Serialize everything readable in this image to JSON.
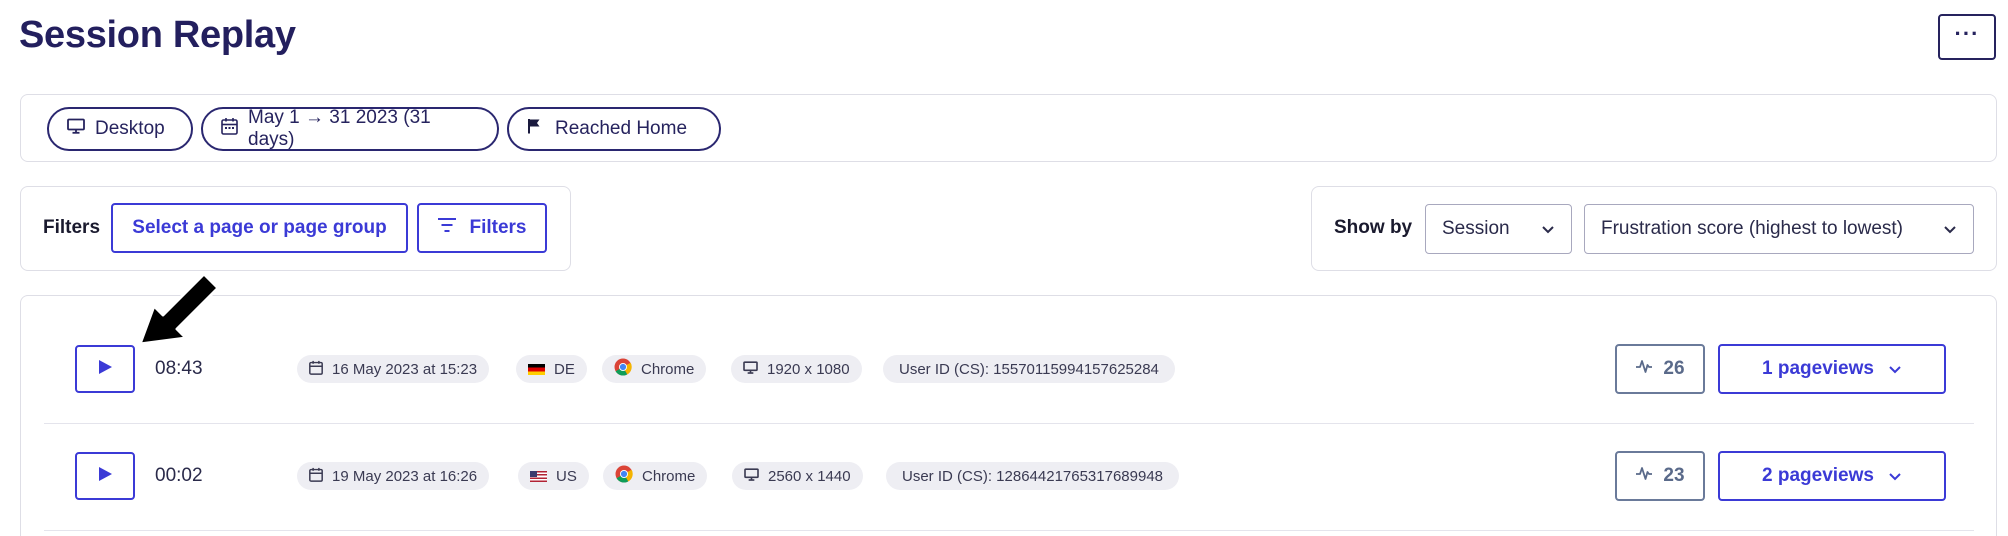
{
  "header": {
    "title": "Session Replay",
    "more_label": "···"
  },
  "context_chips": [
    {
      "label": "Desktop",
      "icon": "monitor-icon"
    },
    {
      "label": "May 1 → 31 2023 (31 days)",
      "icon": "calendar-icon"
    },
    {
      "label": "Reached Home",
      "icon": "flag-icon"
    }
  ],
  "filters": {
    "label": "Filters",
    "page_select_label": "Select a page or page group",
    "filters_button_label": "Filters"
  },
  "sort": {
    "label": "Show by",
    "group_by_value": "Session",
    "order_value": "Frustration score (highest to lowest)"
  },
  "sessions": [
    {
      "duration": "08:43",
      "date": "16 May 2023 at 15:23",
      "country": "DE",
      "browser": "Chrome",
      "resolution": "1920 x 1080",
      "user_id": "User ID (CS): 15570115994157625284",
      "frustration_score": "26",
      "pageviews": "1 pageviews"
    },
    {
      "duration": "00:02",
      "date": "19 May 2023 at 16:26",
      "country": "US",
      "browser": "Chrome",
      "resolution": "2560 x 1440",
      "user_id": "User ID (CS): 12864421765317689948",
      "frustration_score": "23",
      "pageviews": "2 pageviews"
    }
  ],
  "colors": {
    "title": "#231f5e",
    "accent": "#3b3ad6",
    "chip_border": "#2a2770",
    "tag_bg": "#eeeef3"
  }
}
